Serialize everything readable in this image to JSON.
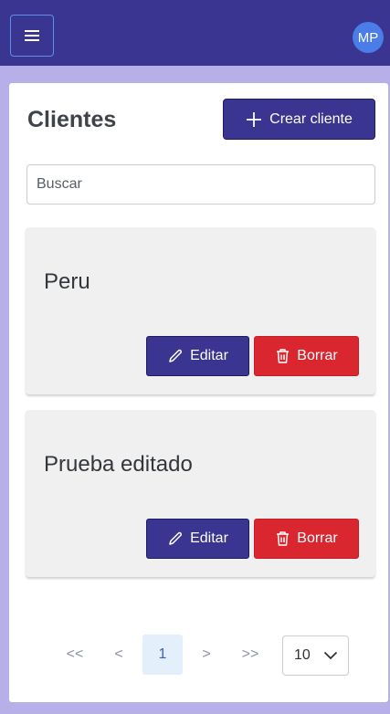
{
  "topbar": {
    "avatar_initials": "MP",
    "menu_icon": "hamburger-icon",
    "bg_color": "#3a3590",
    "avatar_color": "#4a7de8"
  },
  "page": {
    "title": "Clientes",
    "create_label": "Crear cliente",
    "search_placeholder": "Buscar"
  },
  "clients": [
    {
      "name": "Peru",
      "edit_label": "Editar",
      "delete_label": "Borrar"
    },
    {
      "name": "Prueba editado",
      "edit_label": "Editar",
      "delete_label": "Borrar"
    }
  ],
  "pagination": {
    "first": "<<",
    "prev": "<",
    "current": "1",
    "next": ">",
    "last": ">>",
    "page_size": "10"
  },
  "colors": {
    "primary": "#3a3590",
    "danger": "#d9262f",
    "background": "#b7b0e8"
  }
}
